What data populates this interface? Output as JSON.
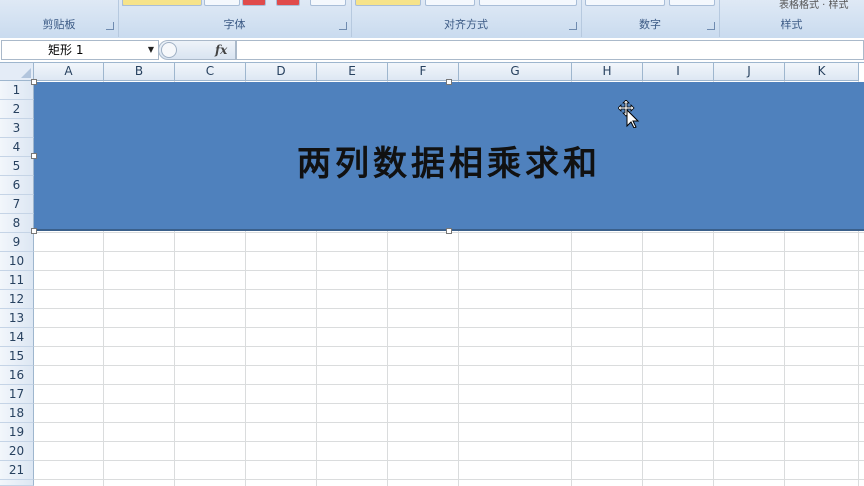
{
  "ribbon": {
    "groups": [
      {
        "label": "剪贴板"
      },
      {
        "label": "字体"
      },
      {
        "label": "对齐方式"
      },
      {
        "label": "数字"
      },
      {
        "label": "样式"
      }
    ],
    "cut_text": "表格格式 · 样式"
  },
  "formula_bar": {
    "name_box_value": "矩形 1",
    "fx_label": "fx",
    "formula_value": ""
  },
  "sheet": {
    "columns": [
      "A",
      "B",
      "C",
      "D",
      "E",
      "F",
      "G",
      "H",
      "I",
      "J",
      "K"
    ],
    "rows": [
      "1",
      "2",
      "3",
      "4",
      "5",
      "6",
      "7",
      "8",
      "9",
      "10",
      "11",
      "12",
      "13",
      "14",
      "15",
      "16",
      "17",
      "18",
      "19",
      "20",
      "21"
    ]
  },
  "shape": {
    "text": "两列数据相乘求和",
    "fill_color": "#4f81bd"
  },
  "icons": {
    "cursor": "move-cursor-icon",
    "launcher": "dialog-launcher-icon",
    "fx": "insert-function-icon"
  }
}
